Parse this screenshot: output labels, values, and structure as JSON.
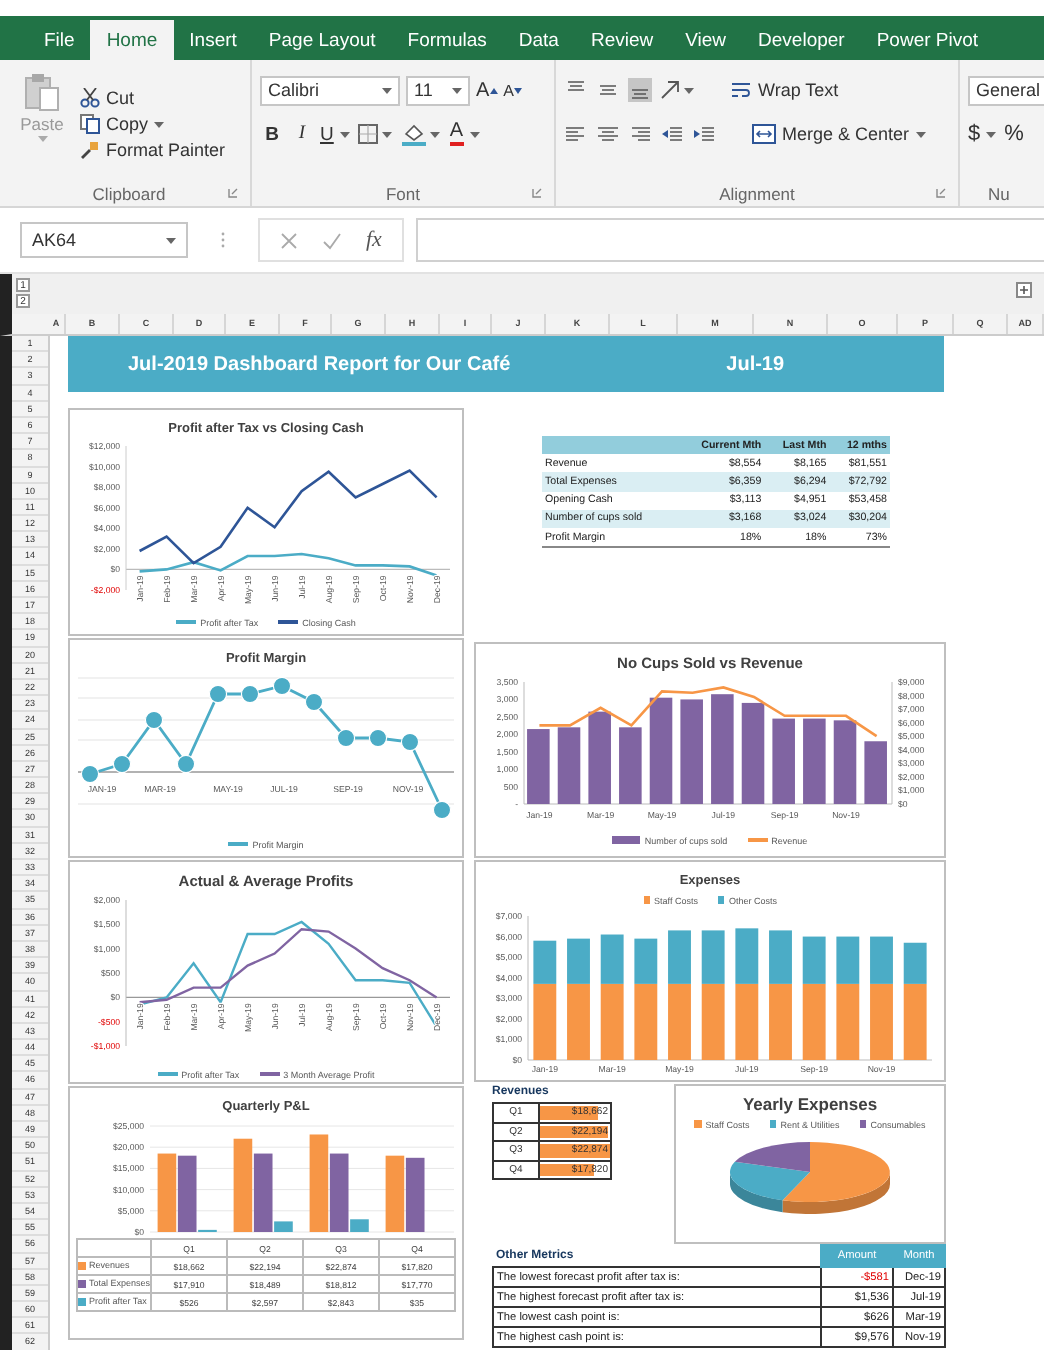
{
  "ribbon_tabs": [
    {
      "label": "File",
      "selected": false
    },
    {
      "label": "Home",
      "selected": true
    },
    {
      "label": "Insert",
      "selected": false
    },
    {
      "label": "Page Layout",
      "selected": false
    },
    {
      "label": "Formulas",
      "selected": false
    },
    {
      "label": "Data",
      "selected": false
    },
    {
      "label": "Review",
      "selected": false
    },
    {
      "label": "View",
      "selected": false
    },
    {
      "label": "Developer",
      "selected": false
    },
    {
      "label": "Power Pivot",
      "selected": false
    }
  ],
  "clipboard": {
    "paste": "Paste",
    "cut": "Cut",
    "copy": "Copy",
    "format_painter": "Format Painter",
    "label": "Clipboard"
  },
  "font": {
    "family": "Calibri",
    "size": "11",
    "grow": "A",
    "shrink": "A",
    "bold": "B",
    "italic": "I",
    "underline": "U",
    "font_color": "A",
    "label": "Font"
  },
  "alignment": {
    "vertical_buttons": [
      {
        "selected": false
      },
      {
        "selected": false
      },
      {
        "selected": true
      }
    ],
    "wrap_text": "Wrap Text",
    "merge_center": "Merge & Center",
    "label": "Alignment"
  },
  "number": {
    "format": "General",
    "currency": "$",
    "percent": "%",
    "label": "Nu"
  },
  "formula_bar": {
    "name_box": "AK64",
    "fx": "fx"
  },
  "outline_levels": [
    "1",
    "2"
  ],
  "column_headers": [
    "A",
    "B",
    "C",
    "D",
    "E",
    "F",
    "G",
    "H",
    "I",
    "J",
    "K",
    "L",
    "M",
    "N",
    "O",
    "P",
    "Q",
    "AD"
  ],
  "row_headers": [
    "1",
    "2",
    "3",
    "4",
    "5",
    "6",
    "7",
    "8",
    "9",
    "10",
    "11",
    "12",
    "13",
    "14",
    "15",
    "16",
    "17",
    "18",
    "19",
    "20",
    "21",
    "22",
    "23",
    "24",
    "25",
    "26",
    "27",
    "28",
    "29",
    "30",
    "31",
    "32",
    "33",
    "34",
    "35",
    "36",
    "37",
    "38",
    "39",
    "40",
    "41",
    "42",
    "43",
    "44",
    "45",
    "46",
    "47",
    "48",
    "49",
    "50",
    "51",
    "52",
    "53",
    "54",
    "55",
    "56",
    "57",
    "58",
    "59",
    "60",
    "61",
    "62"
  ],
  "banner": {
    "title": "Jul-2019 Dashboard Report for Our Café",
    "month": "Jul-19"
  },
  "profit_cash_chart": {
    "chart_data": {
      "type": "line",
      "title": "Profit after Tax vs Closing Cash",
      "legend": "bottom",
      "categories": [
        "Jan-19",
        "Feb-19",
        "Mar-19",
        "Apr-19",
        "May-19",
        "Jun-19",
        "Jul-19",
        "Aug-19",
        "Sep-19",
        "Oct-19",
        "Nov-19",
        "Dec-19"
      ],
      "ylim": [
        -2000,
        12000
      ],
      "yticks": [
        {
          "value": -2000,
          "label": "-$2,000"
        },
        {
          "value": 0,
          "label": "$0"
        },
        {
          "value": 2000,
          "label": "$2,000"
        },
        {
          "value": 4000,
          "label": "$4,000"
        },
        {
          "value": 6000,
          "label": "$6,000"
        },
        {
          "value": 8000,
          "label": "$8,000"
        },
        {
          "value": 10000,
          "label": "$10,000"
        },
        {
          "value": 12000,
          "label": "$12,000"
        }
      ],
      "series": [
        {
          "name": "Profit after Tax",
          "color": "#4bacc6",
          "values": [
            -200,
            0,
            700,
            -100,
            1300,
            1300,
            1500,
            1100,
            400,
            400,
            300,
            -600
          ]
        },
        {
          "name": "Closing Cash",
          "color": "#2e5597",
          "values": [
            1800,
            3200,
            600,
            2200,
            6000,
            4100,
            7600,
            9500,
            7000,
            8300,
            9600,
            7000
          ]
        }
      ]
    }
  },
  "kpi_table": {
    "columns": [
      "Current Mth",
      "Last Mth",
      "12 mths"
    ],
    "rows": [
      {
        "label": "Revenue",
        "values": [
          "$8,554",
          "$8,165",
          "$81,551"
        ]
      },
      {
        "label": "Total Expenses",
        "values": [
          "$6,359",
          "$6,294",
          "$72,792"
        ]
      },
      {
        "label": "Opening Cash",
        "values": [
          "$3,113",
          "$4,951",
          "$53,458"
        ]
      },
      {
        "label": "Number of cups sold",
        "values": [
          "$3,168",
          "$3,024",
          "$30,204"
        ]
      },
      {
        "label": "Profit Margin",
        "values": [
          "18%",
          "18%",
          "73%"
        ]
      }
    ]
  },
  "profit_margin_chart": {
    "title": "Profit Margin",
    "axis_labels": [
      "JAN-19",
      "MAR-19",
      "MAY-19",
      "JUL-19",
      "SEP-19",
      "NOV-19"
    ],
    "legend": "Profit Margin"
  },
  "cups_chart": {
    "bar_chart": {
      "chart_data": {
        "type": "bar",
        "title": "No Cups Sold vs Revenue",
        "legend": "bottom",
        "categories": [
          "Jan-19",
          null,
          "Mar-19",
          null,
          "May-19",
          null,
          "Jul-19",
          null,
          "Sep-19",
          null,
          "Nov-19",
          null
        ],
        "ylim": [
          0,
          3500
        ],
        "yticks": [
          {
            "value": 0,
            "label": "-"
          },
          {
            "value": 500,
            "label": "500"
          },
          {
            "value": 1000,
            "label": "1,000"
          },
          {
            "value": 1500,
            "label": "1,500"
          },
          {
            "value": 2000,
            "label": "2,000"
          },
          {
            "value": 2500,
            "label": "2,500"
          },
          {
            "value": 3000,
            "label": "3,000"
          },
          {
            "value": 3500,
            "label": "3,500"
          }
        ],
        "series": [
          {
            "name": "Number of cups sold",
            "color": "#8064a2",
            "values": [
              2150,
              2200,
              2650,
              2200,
              3050,
              3000,
              3150,
              2900,
              2450,
              2450,
              2400,
              1800
            ]
          }
        ]
      }
    },
    "line_chart": {
      "chart_data": {
        "type": "line",
        "categories": [
          null,
          null,
          null,
          null,
          null,
          null,
          null,
          null,
          null,
          null,
          null,
          null
        ],
        "ylim": [
          0,
          9000
        ],
        "yticks": [
          {
            "value": 0,
            "label": "$0"
          },
          {
            "value": 1000,
            "label": "$1,000"
          },
          {
            "value": 2000,
            "label": "$2,000"
          },
          {
            "value": 3000,
            "label": "$3,000"
          },
          {
            "value": 4000,
            "label": "$4,000"
          },
          {
            "value": 5000,
            "label": "$5,000"
          },
          {
            "value": 6000,
            "label": "$6,000"
          },
          {
            "value": 7000,
            "label": "$7,000"
          },
          {
            "value": 8000,
            "label": "$8,000"
          },
          {
            "value": 9000,
            "label": "$9,000"
          }
        ],
        "series": [
          {
            "name": "Revenue",
            "color": "#f79646",
            "values": [
              5800,
              5800,
              7100,
              5800,
              8300,
              8200,
              8600,
              7900,
              6500,
              6500,
              6500,
              5000
            ]
          }
        ]
      }
    }
  },
  "actual_average_chart": {
    "chart_data": {
      "type": "line",
      "title": "Actual & Average Profits",
      "legend": "bottom",
      "categories": [
        "Jan-19",
        "Feb-19",
        "Mar-19",
        "Apr-19",
        "May-19",
        "Jun-19",
        "Jul-19",
        "Aug-19",
        "Sep-19",
        "Oct-19",
        "Nov-19",
        "Dec-19"
      ],
      "ylim": [
        -1000,
        2000
      ],
      "yticks": [
        {
          "value": -1000,
          "label": "-$1,000"
        },
        {
          "value": -500,
          "label": "-$500"
        },
        {
          "value": 0,
          "label": "$0"
        },
        {
          "value": 500,
          "label": "$500"
        },
        {
          "value": 1000,
          "label": "$1,000"
        },
        {
          "value": 1500,
          "label": "$1,500"
        },
        {
          "value": 2000,
          "label": "$2,000"
        }
      ],
      "series": [
        {
          "name": "Profit after Tax",
          "color": "#4bacc6",
          "values": [
            -150,
            0,
            700,
            -100,
            1300,
            1300,
            1550,
            1100,
            350,
            350,
            300,
            -600
          ]
        },
        {
          "name": "3 Month Average Profit",
          "color": "#8064a2",
          "values": [
            -100,
            -50,
            200,
            200,
            650,
            900,
            1400,
            1350,
            1000,
            600,
            350,
            0
          ]
        }
      ]
    }
  },
  "expenses_chart": {
    "chart_data": {
      "type": "bar",
      "stacked": true,
      "title": "Expenses",
      "legend": "top",
      "categories": [
        "Jan-19",
        null,
        "Mar-19",
        null,
        "May-19",
        null,
        "Jul-19",
        null,
        "Sep-19",
        null,
        "Nov-19",
        null
      ],
      "ylim": [
        0,
        7000
      ],
      "yticks": [
        {
          "value": 0,
          "label": "$0"
        },
        {
          "value": 1000,
          "label": "$1,000"
        },
        {
          "value": 2000,
          "label": "$2,000"
        },
        {
          "value": 3000,
          "label": "$3,000"
        },
        {
          "value": 4000,
          "label": "$4,000"
        },
        {
          "value": 5000,
          "label": "$5,000"
        },
        {
          "value": 6000,
          "label": "$6,000"
        },
        {
          "value": 7000,
          "label": "$7,000"
        }
      ],
      "series": [
        {
          "name": "Staff Costs",
          "color": "#f79646",
          "values": [
            3700,
            3700,
            3700,
            3700,
            3700,
            3700,
            3700,
            3700,
            3700,
            3700,
            3700,
            3700
          ]
        },
        {
          "name": "Other Costs",
          "color": "#4bacc6",
          "values": [
            2100,
            2200,
            2400,
            2200,
            2600,
            2600,
            2700,
            2600,
            2300,
            2300,
            2300,
            2000
          ]
        }
      ]
    }
  },
  "quarterly_chart": {
    "chart_data": {
      "type": "bar",
      "title": "Quarterly P&L",
      "legend": "bottom",
      "grid": true,
      "categories": [
        "Q1",
        "Q2",
        "Q3",
        "Q4"
      ],
      "ylim": [
        0,
        25000
      ],
      "yticks": [
        {
          "value": 0,
          "label": "$0"
        },
        {
          "value": 5000,
          "label": "$5,000"
        },
        {
          "value": 10000,
          "label": "$10,000"
        },
        {
          "value": 15000,
          "label": "$15,000"
        },
        {
          "value": 20000,
          "label": "$20,000"
        },
        {
          "value": 25000,
          "label": "$25,000"
        }
      ],
      "series": [
        {
          "name": "Revenues",
          "color": "#f79646",
          "values": [
            18500,
            22000,
            23000,
            18000
          ]
        },
        {
          "name": "Total Expenses",
          "color": "#8064a2",
          "values": [
            18000,
            18500,
            18500,
            17500
          ]
        },
        {
          "name": "Profit after Tax",
          "color": "#4bacc6",
          "values": [
            500,
            2500,
            3000,
            0
          ]
        }
      ]
    },
    "data_table": [
      {
        "cells": [
          "$18,662",
          "$22,194",
          "$22,874",
          "$17,820"
        ]
      },
      {
        "cells": [
          "$17,910",
          "$18,489",
          "$18,812",
          "$17,770"
        ]
      },
      {
        "cells": [
          "$526",
          "$2,597",
          "$2,843",
          "$35"
        ]
      }
    ]
  },
  "revenues": {
    "title": "Revenues",
    "rows": [
      {
        "quarter": "Q1",
        "value": "$18,662",
        "level": 0.82
      },
      {
        "quarter": "Q2",
        "value": "$22,194",
        "level": 0.97
      },
      {
        "quarter": "Q3",
        "value": "$22,874",
        "level": 1
      },
      {
        "quarter": "Q4",
        "value": "$17,820",
        "level": 0.78
      }
    ]
  },
  "yearly_expenses": {
    "title": "Yearly Expenses",
    "legend": [
      {
        "label": "Staff Costs",
        "color": "#f79646"
      },
      {
        "label": "Rent & Utilities",
        "color": "#4bacc6"
      },
      {
        "label": "Consumables",
        "color": "#8064a2"
      }
    ]
  },
  "other_metrics": {
    "title": "Other Metrics",
    "columns": [
      "Amount",
      "Month"
    ],
    "rows": [
      {
        "label": "The lowest forecast profit after tax is:",
        "amount": "-$581",
        "month": "Dec-19",
        "negative": true
      },
      {
        "label": "The highest forecast profit after tax is:",
        "amount": "$1,536",
        "month": "Jul-19",
        "negative": false
      },
      {
        "label": "The lowest cash point is:",
        "amount": "$626",
        "month": "Mar-19",
        "negative": false
      },
      {
        "label": "The highest cash point is:",
        "amount": "$9,576",
        "month": "Nov-19",
        "negative": false
      }
    ]
  }
}
